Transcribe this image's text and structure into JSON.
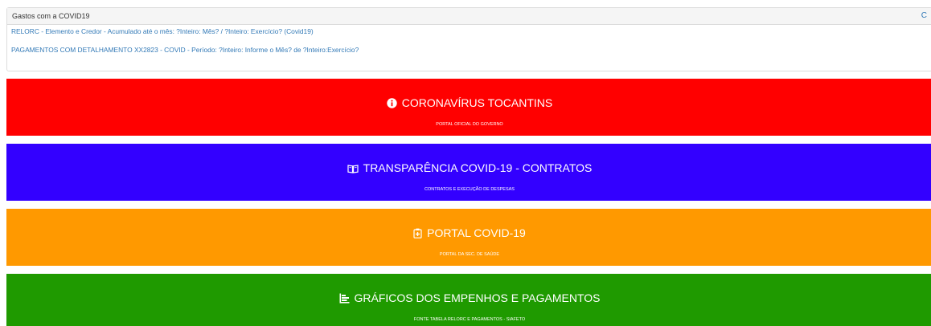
{
  "panel": {
    "title": "Gastos com a COVID19",
    "refresh_icon": "C",
    "links": [
      "RELORC - Elemento e Credor - Acumulado até o mês: ?Inteiro: Mês? / ?Inteiro: Exercício? (Covid19)",
      "PAGAMENTOS COM DETALHAMENTO XX2823 - COVID - Período: ?Inteiro: Informe o Mês? de ?Inteiro:Exercício?"
    ]
  },
  "tiles": [
    {
      "icon": "info-circle-icon",
      "title": "CORONAVÍRUS TOCANTINS",
      "subtitle": "PORTAL OFICIAL DO GOVERNO",
      "color": "#ff0000"
    },
    {
      "icon": "book-open-icon",
      "title": "TRANSPARÊNCIA COVID-19 - CONTRATOS",
      "subtitle": "CONTRATOS E EXECUÇÃO DE DESPESAS",
      "color": "#3300ff"
    },
    {
      "icon": "clipboard-plus-icon",
      "title": "PORTAL COVID-19",
      "subtitle": "PORTAL DA SEC. DE SAÚDE",
      "color": "#ff9900"
    },
    {
      "icon": "bar-chart-icon",
      "title": "GRÁFICOS DOS EMPENHOS E PAGAMENTOS",
      "subtitle": "FONTE TABELA RELORC E PAGAMENTOS - SIAFETO",
      "color": "#1f9a00"
    }
  ]
}
